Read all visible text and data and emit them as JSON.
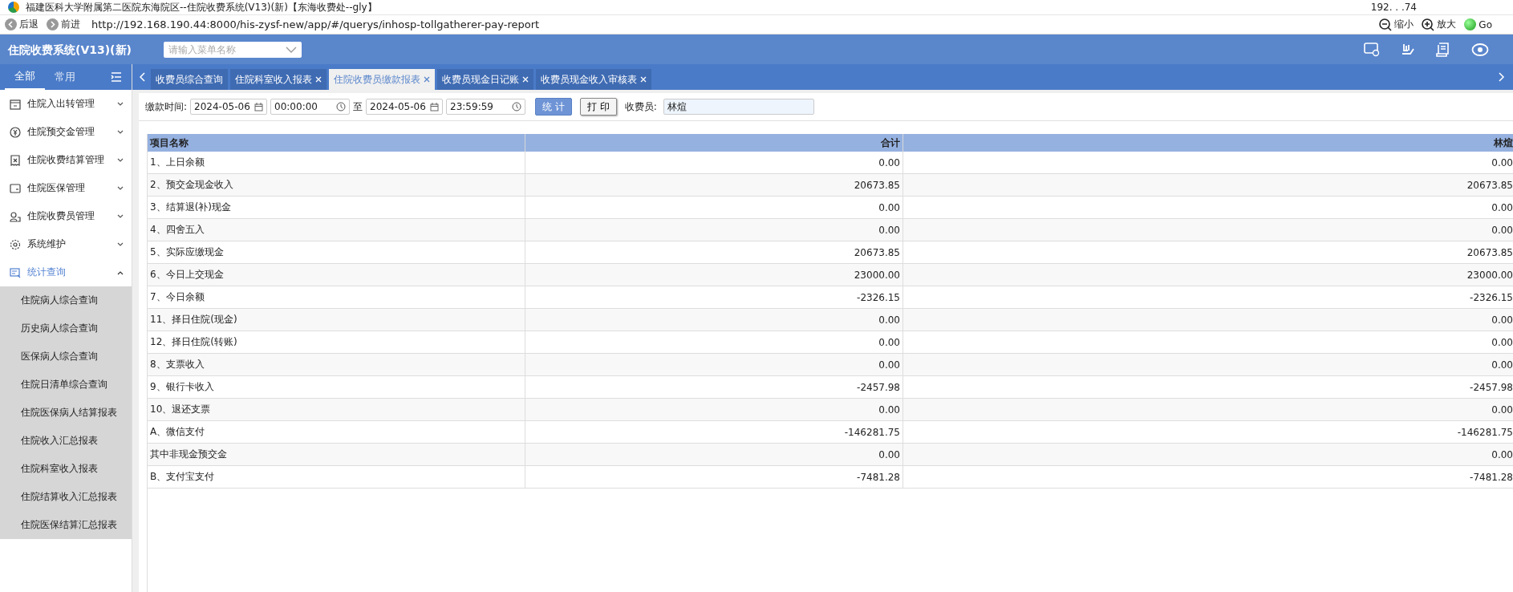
{
  "window": {
    "title": "福建医科大学附属第二医院东海院区--住院收费系统(V13)(新)【东海收费处--gly】",
    "ip": "192. . .74"
  },
  "browser": {
    "back": "后退",
    "forward": "前进",
    "url": "http://192.168.190.44:8000/his-zysf-new/app/#/querys/inhosp-tollgatherer-pay-report",
    "zoom_out": "缩小",
    "zoom_in": "放大",
    "go": "Go"
  },
  "app": {
    "title": "住院收费系统(V13)(新)",
    "menu_search": {
      "placeholder": "请输入菜单名称"
    }
  },
  "sidebar": {
    "tabs": [
      {
        "label": "全部",
        "selected": true
      },
      {
        "label": "常用",
        "selected": false
      }
    ],
    "items": [
      {
        "label": "住院入出转管理",
        "kind": "calendar",
        "expanded": false,
        "selected": false
      },
      {
        "label": "住院预交金管理",
        "kind": "yen",
        "expanded": false,
        "selected": false
      },
      {
        "label": "住院收费结算管理",
        "kind": "receipt",
        "expanded": false,
        "selected": false
      },
      {
        "label": "住院医保管理",
        "kind": "card",
        "expanded": false,
        "selected": false
      },
      {
        "label": "住院收费员管理",
        "kind": "user",
        "expanded": false,
        "selected": false
      },
      {
        "label": "系统维护",
        "kind": "gear",
        "expanded": false,
        "selected": false
      },
      {
        "label": "统计查询",
        "kind": "chart",
        "expanded": true,
        "selected": true,
        "children": [
          {
            "label": "住院病人综合查询"
          },
          {
            "label": "历史病人综合查询"
          },
          {
            "label": "医保病人综合查询"
          },
          {
            "label": "住院日清单综合查询"
          },
          {
            "label": "住院医保病人结算报表"
          },
          {
            "label": "住院收入汇总报表"
          },
          {
            "label": "住院科室收入报表"
          },
          {
            "label": "住院结算收入汇总报表"
          },
          {
            "label": "住院医保结算汇总报表"
          }
        ]
      }
    ]
  },
  "tabs": [
    {
      "label": "收费员综合查询",
      "closable": false,
      "selected": false
    },
    {
      "label": "住院科室收入报表",
      "closable": true,
      "selected": false
    },
    {
      "label": "住院收费员缴款报表",
      "closable": true,
      "selected": true
    },
    {
      "label": "收费员现金日记账",
      "closable": true,
      "selected": false
    },
    {
      "label": "收费员现金收入审核表",
      "closable": true,
      "selected": false
    }
  ],
  "filter": {
    "label": "缴款时间:",
    "start_date": "2024-05-06",
    "start_time": "00:00:00",
    "to": "至",
    "end_date": "2024-05-06",
    "end_time": "23:59:59",
    "stat_button": "统 计",
    "print_button": "打 印",
    "collector_label": "收费员:",
    "collector": "林煊"
  },
  "table": {
    "columns": [
      "项目名称",
      "合计",
      "林煊"
    ],
    "rows": [
      [
        "1、上日余额",
        "0.00",
        "0.00"
      ],
      [
        "2、预交金现金收入",
        "20673.85",
        "20673.85"
      ],
      [
        "3、结算退(补)现金",
        "0.00",
        "0.00"
      ],
      [
        "4、四舍五入",
        "0.00",
        "0.00"
      ],
      [
        "5、实际应缴现金",
        "20673.85",
        "20673.85"
      ],
      [
        "6、今日上交现金",
        "23000.00",
        "23000.00"
      ],
      [
        "7、今日余额",
        "-2326.15",
        "-2326.15"
      ],
      [
        "11、择日住院(现金)",
        "0.00",
        "0.00"
      ],
      [
        "12、择日住院(转账)",
        "0.00",
        "0.00"
      ],
      [
        "8、支票收入",
        "0.00",
        "0.00"
      ],
      [
        "9、银行卡收入",
        "-2457.98",
        "-2457.98"
      ],
      [
        "10、退还支票",
        "0.00",
        "0.00"
      ],
      [
        "A、微信支付",
        "-146281.75",
        "-146281.75"
      ],
      [
        "其中非现金预交金",
        "0.00",
        "0.00"
      ],
      [
        "B、支付宝支付",
        "-7481.28",
        "-7481.28"
      ]
    ]
  }
}
